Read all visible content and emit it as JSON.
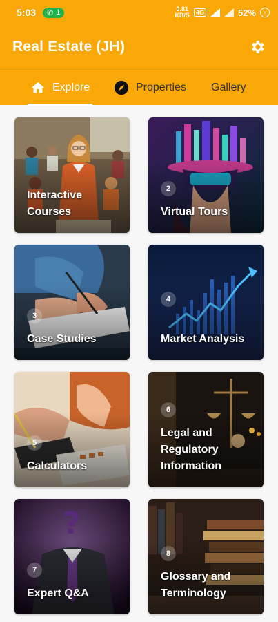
{
  "status_bar": {
    "time": "5:03",
    "pill_count": "1",
    "net_speed_top": "0.81",
    "net_speed_bottom": "KB/S",
    "network_badge": "4G",
    "battery": "52%"
  },
  "app_bar": {
    "title": "Real Estate (JH)"
  },
  "tabs": [
    {
      "label": "Explore",
      "icon": "home-icon",
      "active": true
    },
    {
      "label": "Properties",
      "icon": "compass-icon",
      "active": false
    },
    {
      "label": "Gallery",
      "icon": "",
      "active": false
    }
  ],
  "cards": [
    {
      "number": "",
      "label": "Interactive Courses"
    },
    {
      "number": "2",
      "label": "Virtual Tours"
    },
    {
      "number": "3",
      "label": "Case Studies"
    },
    {
      "number": "4",
      "label": "Market Analysis"
    },
    {
      "number": "5",
      "label": "Calculators"
    },
    {
      "number": "6",
      "label": "Legal and Regulatory Information"
    },
    {
      "number": "7",
      "label": "Expert Q&A"
    },
    {
      "number": "8",
      "label": "Glossary and Terminology"
    }
  ],
  "colors": {
    "accent": "#f9a808",
    "active_tab": "#ffffff",
    "inactive_tab": "#333333"
  }
}
